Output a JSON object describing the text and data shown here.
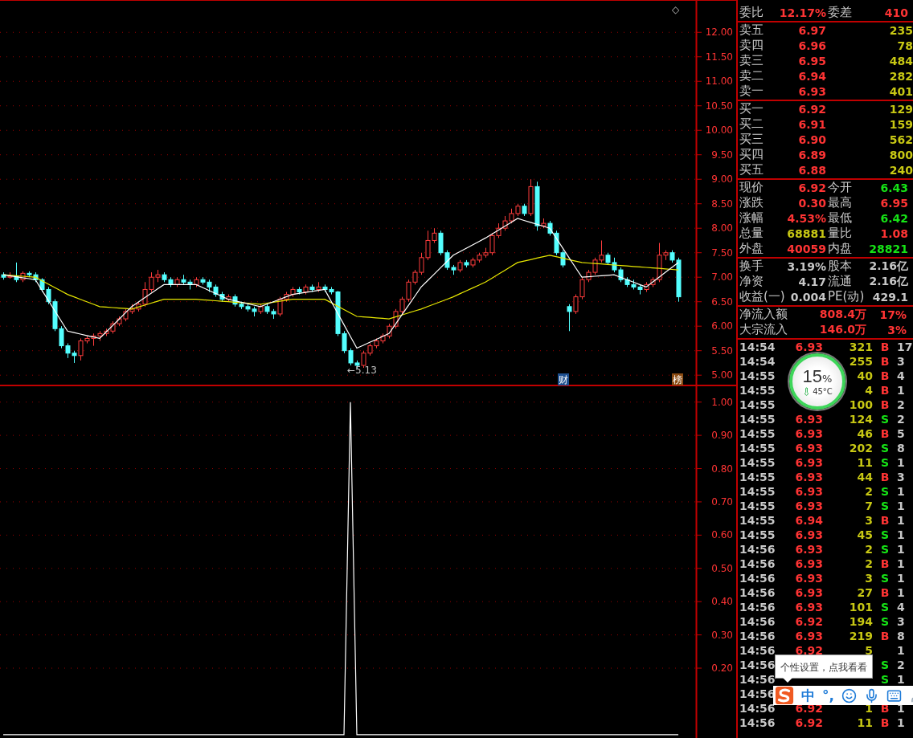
{
  "price_chart": {
    "corner_mark": "◇",
    "low_marker": "←5.13",
    "badges": [
      {
        "text": "财",
        "kind": "finance"
      },
      {
        "text": "榜",
        "kind": "ranking"
      }
    ],
    "chart_data": {
      "type": "candlestick",
      "grid": true,
      "ylim": [
        4.79,
        12.66
      ],
      "yticks": [
        {
          "value": 12,
          "label": "12.00"
        },
        {
          "value": 11.5,
          "label": "11.50"
        },
        {
          "value": 11,
          "label": "11.00"
        },
        {
          "value": 10.5,
          "label": "10.50"
        },
        {
          "value": 10,
          "label": "10.00"
        },
        {
          "value": 9.5,
          "label": "9.50"
        },
        {
          "value": 9,
          "label": "9.00"
        },
        {
          "value": 8.5,
          "label": "8.50"
        },
        {
          "value": 8,
          "label": "8.00"
        },
        {
          "value": 7.5,
          "label": "7.50"
        },
        {
          "value": 7,
          "label": "7.00"
        },
        {
          "value": 6.5,
          "label": "6.50"
        },
        {
          "value": 6,
          "label": "6.00"
        },
        {
          "value": 5.5,
          "label": "5.50"
        },
        {
          "value": 5,
          "label": "5.00"
        }
      ],
      "ohlc": [
        [
          7.05,
          7.1,
          6.95,
          7.0
        ],
        [
          7.0,
          7.1,
          6.97,
          7.02
        ],
        [
          7.02,
          7.3,
          6.9,
          6.95
        ],
        [
          6.95,
          7.12,
          6.9,
          7.08
        ],
        [
          7.08,
          7.12,
          7.0,
          7.05
        ],
        [
          7.05,
          7.1,
          6.9,
          6.95
        ],
        [
          6.95,
          6.98,
          6.7,
          6.75
        ],
        [
          6.75,
          6.8,
          6.45,
          6.5
        ],
        [
          6.5,
          6.55,
          5.9,
          5.95
        ],
        [
          5.95,
          6.0,
          5.55,
          5.6
        ],
        [
          5.6,
          5.65,
          5.35,
          5.45
        ],
        [
          5.45,
          5.5,
          5.25,
          5.4
        ],
        [
          5.4,
          5.75,
          5.3,
          5.7
        ],
        [
          5.7,
          5.8,
          5.65,
          5.75
        ],
        [
          5.75,
          5.85,
          5.6,
          5.8
        ],
        [
          5.8,
          5.9,
          5.7,
          5.85
        ],
        [
          5.85,
          5.95,
          5.8,
          5.9
        ],
        [
          5.9,
          6.1,
          5.85,
          6.05
        ],
        [
          6.05,
          6.2,
          6.0,
          6.15
        ],
        [
          6.15,
          6.35,
          6.1,
          6.3
        ],
        [
          6.3,
          6.45,
          6.25,
          6.35
        ],
        [
          6.35,
          6.5,
          6.3,
          6.45
        ],
        [
          6.45,
          6.9,
          6.4,
          6.75
        ],
        [
          6.75,
          7.1,
          6.7,
          7.0
        ],
        [
          7.0,
          7.15,
          6.9,
          7.05
        ],
        [
          7.05,
          7.1,
          6.9,
          6.95
        ],
        [
          6.95,
          7.0,
          6.8,
          6.85
        ],
        [
          6.85,
          7.0,
          6.8,
          6.95
        ],
        [
          6.95,
          7.05,
          6.85,
          6.9
        ],
        [
          6.9,
          6.95,
          6.75,
          6.85
        ],
        [
          6.85,
          7.0,
          6.8,
          6.95
        ],
        [
          6.95,
          7.0,
          6.85,
          6.9
        ],
        [
          6.9,
          6.95,
          6.7,
          6.8
        ],
        [
          6.8,
          6.85,
          6.6,
          6.65
        ],
        [
          6.65,
          6.7,
          6.5,
          6.55
        ],
        [
          6.55,
          6.65,
          6.5,
          6.6
        ],
        [
          6.6,
          6.65,
          6.4,
          6.45
        ],
        [
          6.45,
          6.5,
          6.35,
          6.4
        ],
        [
          6.4,
          6.45,
          6.3,
          6.35
        ],
        [
          6.35,
          6.4,
          6.2,
          6.3
        ],
        [
          6.3,
          6.45,
          6.25,
          6.4
        ],
        [
          6.4,
          6.45,
          6.25,
          6.3
        ],
        [
          6.3,
          6.35,
          6.15,
          6.25
        ],
        [
          6.25,
          6.6,
          6.2,
          6.55
        ],
        [
          6.55,
          6.7,
          6.5,
          6.65
        ],
        [
          6.65,
          6.8,
          6.6,
          6.75
        ],
        [
          6.75,
          6.8,
          6.65,
          6.7
        ],
        [
          6.7,
          6.85,
          6.65,
          6.8
        ],
        [
          6.8,
          6.85,
          6.7,
          6.75
        ],
        [
          6.75,
          6.9,
          6.7,
          6.8
        ],
        [
          6.8,
          6.85,
          6.7,
          6.75
        ],
        [
          6.75,
          6.8,
          6.65,
          6.7
        ],
        [
          6.7,
          6.72,
          5.8,
          5.85
        ],
        [
          5.85,
          5.9,
          5.45,
          5.5
        ],
        [
          5.5,
          5.55,
          5.2,
          5.25
        ],
        [
          5.25,
          5.3,
          5.13,
          5.2
        ],
        [
          5.2,
          5.5,
          5.15,
          5.45
        ],
        [
          5.45,
          5.65,
          5.4,
          5.6
        ],
        [
          5.6,
          5.75,
          5.55,
          5.7
        ],
        [
          5.7,
          5.85,
          5.65,
          5.8
        ],
        [
          5.8,
          6.05,
          5.75,
          6.0
        ],
        [
          6.0,
          6.35,
          5.95,
          6.3
        ],
        [
          6.3,
          6.6,
          6.25,
          6.55
        ],
        [
          6.55,
          6.95,
          6.5,
          6.9
        ],
        [
          6.9,
          7.15,
          6.85,
          7.1
        ],
        [
          7.1,
          7.5,
          7.05,
          7.4
        ],
        [
          7.4,
          7.95,
          7.35,
          7.75
        ],
        [
          7.75,
          8.0,
          7.7,
          7.9
        ],
        [
          7.9,
          7.95,
          7.45,
          7.5
        ],
        [
          7.5,
          7.55,
          7.15,
          7.2
        ],
        [
          7.2,
          7.25,
          7.05,
          7.15
        ],
        [
          7.15,
          7.35,
          7.1,
          7.3
        ],
        [
          7.3,
          7.35,
          7.2,
          7.25
        ],
        [
          7.25,
          7.4,
          7.2,
          7.35
        ],
        [
          7.35,
          7.5,
          7.3,
          7.45
        ],
        [
          7.45,
          7.6,
          7.4,
          7.5
        ],
        [
          7.5,
          7.9,
          7.45,
          7.85
        ],
        [
          7.85,
          8.1,
          7.8,
          8.0
        ],
        [
          8.0,
          8.25,
          7.95,
          8.15
        ],
        [
          8.15,
          8.4,
          8.1,
          8.3
        ],
        [
          8.3,
          8.5,
          8.25,
          8.45
        ],
        [
          8.45,
          8.5,
          8.25,
          8.3
        ],
        [
          8.3,
          9.0,
          8.25,
          8.85
        ],
        [
          8.85,
          8.95,
          7.95,
          8.05
        ],
        [
          8.05,
          8.2,
          8.0,
          8.1
        ],
        [
          8.1,
          8.15,
          7.85,
          7.9
        ],
        [
          7.9,
          7.95,
          7.45,
          7.5
        ],
        [
          7.5,
          7.55,
          7.2,
          7.25
        ],
        [
          6.4,
          6.45,
          5.9,
          6.3
        ],
        [
          6.3,
          6.65,
          6.25,
          6.6
        ],
        [
          6.6,
          7.0,
          6.55,
          6.95
        ],
        [
          6.95,
          7.15,
          6.9,
          7.1
        ],
        [
          7.1,
          7.4,
          7.05,
          7.35
        ],
        [
          7.35,
          7.75,
          7.3,
          7.45
        ],
        [
          7.45,
          7.5,
          7.25,
          7.3
        ],
        [
          7.3,
          7.4,
          7.1,
          7.15
        ],
        [
          7.15,
          7.2,
          6.9,
          6.95
        ],
        [
          6.95,
          7.0,
          6.8,
          6.85
        ],
        [
          6.85,
          6.95,
          6.75,
          6.8
        ],
        [
          6.8,
          6.85,
          6.65,
          6.75
        ],
        [
          6.75,
          6.9,
          6.7,
          6.85
        ],
        [
          6.85,
          7.0,
          6.8,
          6.95
        ],
        [
          6.95,
          7.7,
          6.9,
          7.45
        ],
        [
          7.45,
          7.55,
          7.35,
          7.5
        ],
        [
          7.5,
          7.55,
          7.3,
          7.35
        ],
        [
          7.35,
          7.4,
          6.5,
          6.6
        ]
      ],
      "series": [
        {
          "type": "line",
          "color": "#e8e800",
          "values": [
            7.05,
            7.04,
            7.03,
            7.02,
            7.01,
            7.0,
            6.93,
            6.86,
            6.79,
            6.72,
            6.65,
            6.6,
            6.55,
            6.5,
            6.45,
            6.4,
            6.39,
            6.38,
            6.37,
            6.36,
            6.35,
            6.39,
            6.43,
            6.47,
            6.51,
            6.55,
            6.55,
            6.55,
            6.55,
            6.55,
            6.55,
            6.54,
            6.53,
            6.52,
            6.51,
            6.5,
            6.49,
            6.48,
            6.47,
            6.46,
            6.45,
            6.47,
            6.49,
            6.51,
            6.53,
            6.55,
            6.55,
            6.55,
            6.55,
            6.55,
            6.55,
            6.48,
            6.41,
            6.34,
            6.27,
            6.2,
            6.19,
            6.18,
            6.17,
            6.16,
            6.15,
            6.19,
            6.23,
            6.27,
            6.31,
            6.35,
            6.4,
            6.45,
            6.5,
            6.55,
            6.6,
            6.66,
            6.72,
            6.78,
            6.84,
            6.9,
            6.98,
            7.06,
            7.14,
            7.22,
            7.3,
            7.33,
            7.36,
            7.39,
            7.42,
            7.45,
            7.42,
            7.39,
            7.36,
            7.33,
            7.3,
            7.29,
            7.28,
            7.27,
            7.26,
            7.25,
            7.24,
            7.23,
            7.22,
            7.21,
            7.2,
            7.19,
            7.18,
            7.17,
            7.16,
            7.15
          ]
        },
        {
          "type": "line",
          "color": "#ffffff",
          "values": [
            7.05,
            7.03,
            7.01,
            6.99,
            6.97,
            6.95,
            6.74,
            6.53,
            6.32,
            6.11,
            5.9,
            5.87,
            5.84,
            5.81,
            5.78,
            5.75,
            5.88,
            6.01,
            6.14,
            6.27,
            6.4,
            6.49,
            6.58,
            6.67,
            6.76,
            6.85,
            6.85,
            6.85,
            6.85,
            6.85,
            6.85,
            6.79,
            6.73,
            6.67,
            6.61,
            6.55,
            6.52,
            6.49,
            6.46,
            6.43,
            6.4,
            6.45,
            6.5,
            6.55,
            6.6,
            6.65,
            6.67,
            6.69,
            6.71,
            6.73,
            6.75,
            6.51,
            6.27,
            6.03,
            5.79,
            5.55,
            5.61,
            5.67,
            5.73,
            5.79,
            5.85,
            6.04,
            6.23,
            6.42,
            6.61,
            6.8,
            6.93,
            7.06,
            7.19,
            7.32,
            7.45,
            7.52,
            7.59,
            7.66,
            7.73,
            7.8,
            7.88,
            7.96,
            8.04,
            8.12,
            8.2,
            8.16,
            8.12,
            8.08,
            8.04,
            8.0,
            7.8,
            7.6,
            7.4,
            7.2,
            7.0,
            7.01,
            7.02,
            7.03,
            7.04,
            7.05,
            7.0,
            6.95,
            6.9,
            6.85,
            6.8,
            6.9,
            7.0,
            7.1,
            7.2,
            7.3
          ]
        }
      ]
    }
  },
  "indicator_chart": {
    "chart_data": {
      "type": "line",
      "grid": true,
      "ylim": [
        -0.01,
        1.05
      ],
      "yticks": [
        {
          "value": 1,
          "label": "1.00"
        },
        {
          "value": 0.9,
          "label": "0.90"
        },
        {
          "value": 0.8,
          "label": "0.80"
        },
        {
          "value": 0.7,
          "label": "0.70"
        },
        {
          "value": 0.6,
          "label": "0.60"
        },
        {
          "value": 0.5,
          "label": "0.50"
        },
        {
          "value": 0.4,
          "label": "0.40"
        },
        {
          "value": 0.3,
          "label": "0.30"
        },
        {
          "value": 0.2,
          "label": "0.20"
        }
      ],
      "series": [
        {
          "color": "#ffffff",
          "values": [
            0,
            0,
            0,
            0,
            0,
            0,
            0,
            0,
            0,
            0,
            0,
            0,
            0,
            0,
            0,
            0,
            0,
            0,
            0,
            0,
            0,
            0,
            0,
            0,
            0,
            0,
            0,
            0,
            0,
            0,
            0,
            0,
            0,
            0,
            0,
            0,
            0,
            0,
            0,
            0,
            0,
            0,
            0,
            0,
            0,
            0,
            0,
            0,
            0,
            0,
            0,
            0,
            0,
            0,
            1,
            0,
            0,
            0,
            0,
            0,
            0,
            0,
            0,
            0,
            0,
            0,
            0,
            0,
            0,
            0,
            0,
            0,
            0,
            0,
            0,
            0,
            0,
            0,
            0,
            0,
            0,
            0,
            0,
            0,
            0,
            0,
            0,
            0,
            0,
            0,
            0,
            0,
            0,
            0,
            0,
            0,
            0,
            0,
            0,
            0,
            0,
            0,
            0,
            0,
            0,
            0
          ]
        }
      ]
    }
  },
  "quote_panel": {
    "order_ratio": {
      "cells": [
        {
          "label": "委比",
          "value": "12.17%",
          "color": "#ff3434"
        },
        {
          "label": "委差",
          "value": "410",
          "color": "#ff3434"
        }
      ]
    },
    "asks": [
      {
        "label": "卖五",
        "price": "6.97",
        "volume": "235"
      },
      {
        "label": "卖四",
        "price": "6.96",
        "volume": "78"
      },
      {
        "label": "卖三",
        "price": "6.95",
        "volume": "484"
      },
      {
        "label": "卖二",
        "price": "6.94",
        "volume": "282"
      },
      {
        "label": "卖一",
        "price": "6.93",
        "volume": "401"
      }
    ],
    "bids": [
      {
        "label": "买一",
        "price": "6.92",
        "volume": "129"
      },
      {
        "label": "买二",
        "price": "6.91",
        "volume": "159"
      },
      {
        "label": "买三",
        "price": "6.90",
        "volume": "562"
      },
      {
        "label": "买四",
        "price": "6.89",
        "volume": "800"
      },
      {
        "label": "买五",
        "price": "6.88",
        "volume": "240"
      }
    ],
    "stats": [
      {
        "cells": [
          {
            "label": "现价",
            "value": "6.92",
            "color": "#ff3434"
          },
          {
            "label": "今开",
            "value": "6.43",
            "color": "#16e316"
          }
        ]
      },
      {
        "cells": [
          {
            "label": "涨跌",
            "value": "0.30",
            "color": "#ff3434"
          },
          {
            "label": "最高",
            "value": "6.95",
            "color": "#ff3434"
          }
        ]
      },
      {
        "cells": [
          {
            "label": "涨幅",
            "value": "4.53%",
            "color": "#ff3434"
          },
          {
            "label": "最低",
            "value": "6.42",
            "color": "#16e316"
          }
        ]
      },
      {
        "cells": [
          {
            "label": "总量",
            "value": "68881",
            "color": "#c8c814"
          },
          {
            "label": "量比",
            "value": "1.08",
            "color": "#ff3434"
          }
        ]
      },
      {
        "cells": [
          {
            "label": "外盘",
            "value": "40059",
            "color": "#ff3434"
          },
          {
            "label": "内盘",
            "value": "28821",
            "color": "#16e316"
          }
        ]
      }
    ],
    "fundamentals": [
      {
        "cells": [
          {
            "label": "换手",
            "value": "3.19%"
          },
          {
            "label": "股本",
            "value": "2.16亿"
          }
        ]
      },
      {
        "cells": [
          {
            "label": "净资",
            "value": "4.17"
          },
          {
            "label": "流通",
            "value": "2.16亿"
          }
        ]
      },
      {
        "cells": [
          {
            "label": "收益(一)",
            "value": "0.004"
          },
          {
            "label": "PE(动)",
            "value": "429.1"
          }
        ]
      }
    ],
    "flows": [
      {
        "label": "净流入额",
        "value": "808.4万",
        "share": "17%"
      },
      {
        "label": "大宗流入",
        "value": "146.0万",
        "share": "3%"
      }
    ],
    "ticks": [
      {
        "time": "14:54",
        "price": "6.93",
        "volume": "321",
        "side": "B",
        "color": "#ff3434",
        "extra": "17"
      },
      {
        "time": "14:54",
        "volume": "255",
        "side": "B",
        "color": "#ff3434",
        "extra": "3"
      },
      {
        "time": "14:55",
        "volume": "40",
        "side": "B",
        "color": "#ff3434",
        "extra": "4"
      },
      {
        "time": "14:55",
        "volume": "4",
        "side": "B",
        "color": "#ff3434",
        "extra": "1"
      },
      {
        "time": "14:55",
        "volume": "100",
        "side": "B",
        "color": "#ff3434",
        "extra": "2"
      },
      {
        "time": "14:55",
        "price": "6.93",
        "volume": "124",
        "side": "S",
        "color": "#16e316",
        "extra": "2"
      },
      {
        "time": "14:55",
        "price": "6.93",
        "volume": "46",
        "side": "B",
        "color": "#ff3434",
        "extra": "5"
      },
      {
        "time": "14:55",
        "price": "6.93",
        "volume": "202",
        "side": "S",
        "color": "#16e316",
        "extra": "8"
      },
      {
        "time": "14:55",
        "price": "6.93",
        "volume": "11",
        "side": "S",
        "color": "#16e316",
        "extra": "1"
      },
      {
        "time": "14:55",
        "price": "6.93",
        "volume": "44",
        "side": "B",
        "color": "#ff3434",
        "extra": "3"
      },
      {
        "time": "14:55",
        "price": "6.93",
        "volume": "2",
        "side": "S",
        "color": "#16e316",
        "extra": "1"
      },
      {
        "time": "14:55",
        "price": "6.93",
        "volume": "7",
        "side": "S",
        "color": "#16e316",
        "extra": "1"
      },
      {
        "time": "14:55",
        "price": "6.94",
        "volume": "3",
        "side": "B",
        "color": "#ff3434",
        "extra": "1"
      },
      {
        "time": "14:55",
        "price": "6.93",
        "volume": "45",
        "side": "S",
        "color": "#16e316",
        "extra": "1"
      },
      {
        "time": "14:56",
        "price": "6.93",
        "volume": "2",
        "side": "S",
        "color": "#16e316",
        "extra": "1"
      },
      {
        "time": "14:56",
        "price": "6.93",
        "volume": "2",
        "side": "B",
        "color": "#ff3434",
        "extra": "1"
      },
      {
        "time": "14:56",
        "price": "6.93",
        "volume": "3",
        "side": "S",
        "color": "#16e316",
        "extra": "1"
      },
      {
        "time": "14:56",
        "price": "6.93",
        "volume": "27",
        "side": "B",
        "color": "#ff3434",
        "extra": "1"
      },
      {
        "time": "14:56",
        "price": "6.93",
        "volume": "101",
        "side": "S",
        "color": "#16e316",
        "extra": "4"
      },
      {
        "time": "14:56",
        "price": "6.92",
        "volume": "194",
        "side": "S",
        "color": "#16e316",
        "extra": "3"
      },
      {
        "time": "14:56",
        "price": "6.93",
        "volume": "219",
        "side": "B",
        "color": "#ff3434",
        "extra": "8"
      },
      {
        "time": "14:56",
        "price": "6.92",
        "volume": "5",
        "extra": "1"
      },
      {
        "time": "14:56",
        "side": "S",
        "color": "#16e316",
        "extra": "2"
      },
      {
        "time": "14:56",
        "side": "S",
        "color": "#16e316",
        "extra": "1"
      },
      {
        "time": "14:56"
      },
      {
        "time": "14:56",
        "price": "6.92",
        "volume": "1",
        "side": "B",
        "color": "#ff3434",
        "extra": "1"
      },
      {
        "time": "14:56",
        "price": "6.92",
        "volume": "11",
        "side": "B",
        "color": "#ff3434",
        "extra": "1"
      }
    ]
  },
  "overlays": {
    "cpu_widget": {
      "percent": "15",
      "percent_unit": "%",
      "temperature": "45°C"
    },
    "ime": {
      "tooltip": "个性设置，点我看看",
      "mode": "中",
      "punctuation": "°,"
    }
  }
}
